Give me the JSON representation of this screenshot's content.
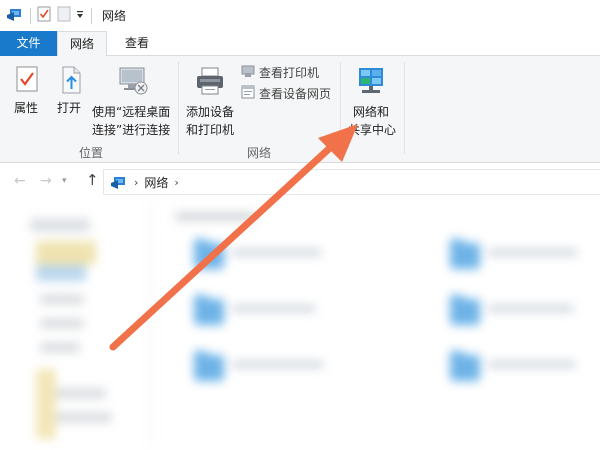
{
  "window": {
    "title": "网络"
  },
  "tabs": [
    {
      "label": "文件"
    },
    {
      "label": "网络"
    },
    {
      "label": "查看"
    }
  ],
  "ribbon": {
    "location_group": {
      "label": "位置",
      "properties": "属性",
      "open": "打开",
      "remote_line1": "使用“远程桌面",
      "remote_line2": "连接”进行连接"
    },
    "network_group": {
      "label": "网络",
      "add_device_line1": "添加设备",
      "add_device_line2": "和打印机",
      "view_printers": "查看打印机",
      "view_device_webpage": "查看设备网页",
      "sharing_center_line1": "网络和",
      "sharing_center_line2": "共享中心"
    }
  },
  "address_bar": {
    "crumb": "网络"
  },
  "colors": {
    "accent": "#1979ca",
    "arrow": "#f0714a",
    "ribbon_bg": "#f5f6f7"
  }
}
